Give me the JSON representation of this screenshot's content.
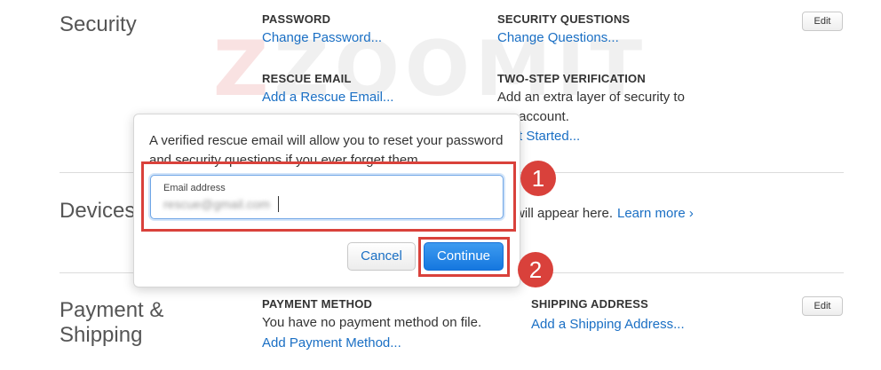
{
  "security": {
    "title": "Security",
    "password": {
      "label": "PASSWORD",
      "link": "Change Password..."
    },
    "security_questions": {
      "label": "SECURITY QUESTIONS",
      "link": "Change Questions..."
    },
    "rescue_email": {
      "label": "RESCUE EMAIL",
      "link": "Add a Rescue Email..."
    },
    "two_step": {
      "label": "TWO-STEP VERIFICATION",
      "line1": "Add an extra layer of security to",
      "line2": "r account.",
      "link": "t Started..."
    },
    "edit": "Edit"
  },
  "devices": {
    "title": "Devices",
    "text": "will appear here.",
    "link": "Learn more ›"
  },
  "payment": {
    "title_line1": "Payment &",
    "title_line2": "Shipping",
    "method": {
      "label": "PAYMENT METHOD",
      "text": "You have no payment method on file.",
      "link": "Add Payment Method..."
    },
    "shipping": {
      "label": "SHIPPING ADDRESS",
      "link": "Add a Shipping Address..."
    },
    "edit": "Edit"
  },
  "popover": {
    "message": "A verified rescue email will allow you to reset your password and security questions if you ever forget them.",
    "input_label": "Email address",
    "input_value": "rescue@gmail.com",
    "cancel": "Cancel",
    "continue": "Continue"
  },
  "annotations": {
    "step1": "1",
    "step2": "2",
    "color": "#d9413b"
  },
  "watermark": {
    "z": "Z",
    "text": "ZOOMIT"
  },
  "colors": {
    "link": "#1a6fc4",
    "primary_button": "#1577df"
  }
}
